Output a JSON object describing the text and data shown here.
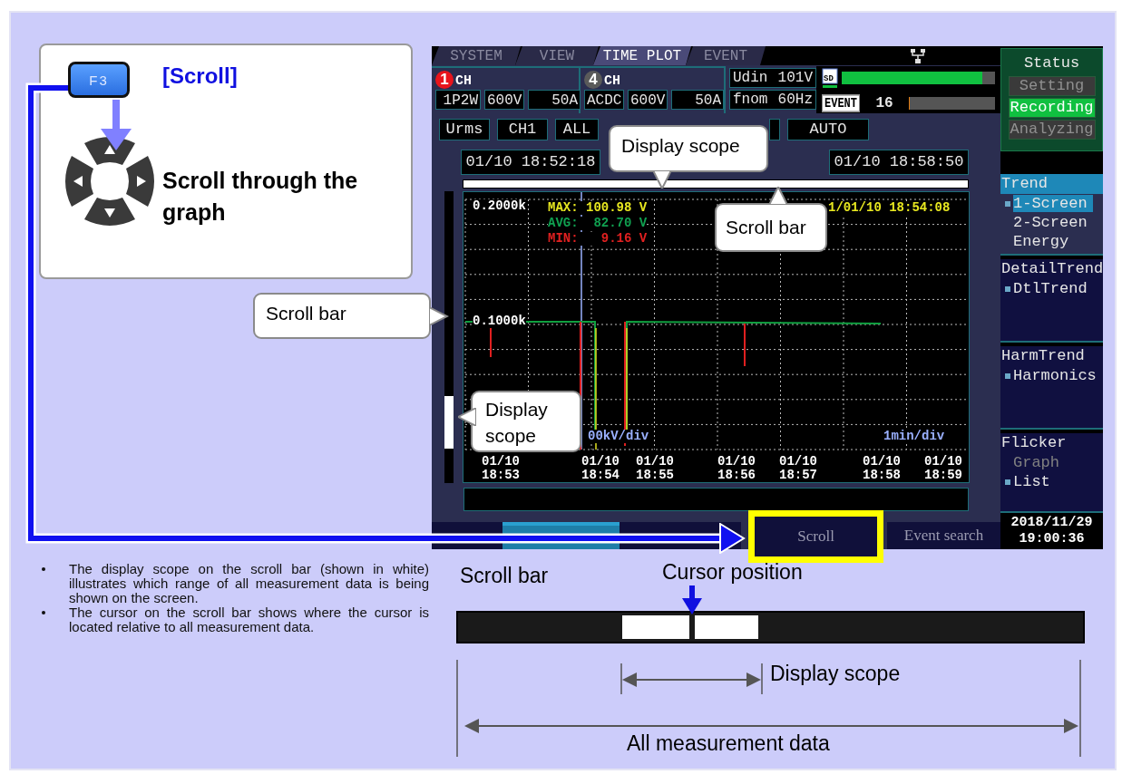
{
  "key_card": {
    "key_label": "F3",
    "title": "[Scroll]",
    "description": "Scroll through the graph"
  },
  "screen": {
    "tabs": [
      {
        "label": "SYSTEM",
        "selected": false
      },
      {
        "label": "VIEW",
        "selected": false
      },
      {
        "label": "TIME PLOT",
        "selected": true
      },
      {
        "label": "EVENT",
        "selected": false
      }
    ],
    "channels": [
      {
        "number": "1",
        "label": "CH",
        "color": "#e8141c",
        "fields": [
          "1P2W",
          "600V",
          "50A"
        ]
      },
      {
        "number": "4",
        "label": "CH",
        "color": "#5a5a5a",
        "fields": [
          "ACDC",
          "600V",
          "50A"
        ]
      }
    ],
    "nominal": [
      {
        "label": "Udin",
        "value": "101V"
      },
      {
        "label": "fnom",
        "value": "60Hz"
      }
    ],
    "sd": {
      "label": "SD",
      "level": 0.92
    },
    "event": {
      "badge": "EVENT",
      "count": "16",
      "level": 0.01
    },
    "status": {
      "title": "Status",
      "items": [
        {
          "label": "Setting",
          "selected": false
        },
        {
          "label": "Recording",
          "selected": true
        },
        {
          "label": "Analyzing",
          "selected": false
        }
      ]
    },
    "selectors": [
      {
        "kind": "text",
        "label": "Urms"
      },
      {
        "kind": "text",
        "label": "CH1"
      },
      {
        "kind": "text",
        "label": "ALL"
      },
      {
        "kind": "covered"
      },
      {
        "kind": "text",
        "label": "AUTO"
      }
    ],
    "start_time": "01/10 18:52:18",
    "end_time": "01/10 18:58:50",
    "graph": {
      "y_ticks": [
        "0.2000k",
        "0.1000k"
      ],
      "max": "MAX: 100.98 V",
      "avg": "AVG:  82.70 V",
      "min": "MIN:   9.16 V",
      "cursor_time": "1/01/10 18:54:08",
      "y_scale": "00kV/div",
      "x_scale": "1min/div",
      "x_labels": [
        {
          "date": "01/10",
          "time": "18:53"
        },
        {
          "date": "01/10",
          "time": "18:54"
        },
        {
          "date": "01/10",
          "time": "18:55"
        },
        {
          "date": "01/10",
          "time": "18:56"
        },
        {
          "date": "01/10",
          "time": "18:57"
        },
        {
          "date": "01/10",
          "time": "18:58"
        },
        {
          "date": "01/10",
          "time": "18:59"
        }
      ]
    },
    "sidebar": [
      {
        "title": "Trend",
        "selected": true,
        "items": [
          {
            "label": "1-Screen",
            "selected": true,
            "current": true,
            "disabled": false
          },
          {
            "label": "2-Screen",
            "selected": false,
            "current": false,
            "disabled": false
          },
          {
            "label": "Energy",
            "selected": false,
            "current": false,
            "disabled": false
          }
        ]
      },
      {
        "title": "DetailTrend",
        "selected": false,
        "items": [
          {
            "label": "DtlTrend",
            "selected": false,
            "current": true,
            "disabled": false
          }
        ]
      },
      {
        "title": "HarmTrend",
        "selected": false,
        "items": [
          {
            "label": "Harmonics",
            "selected": false,
            "current": true,
            "disabled": false
          }
        ]
      },
      {
        "title": "Flicker",
        "selected": false,
        "items": [
          {
            "label": "Graph",
            "selected": false,
            "current": false,
            "disabled": true
          },
          {
            "label": "List",
            "selected": false,
            "current": true,
            "disabled": false
          }
        ]
      }
    ],
    "date": "2018/11/29",
    "time": "19:00:36",
    "keys": [
      {
        "kind": "blank",
        "selected": false,
        "highlighted": false
      },
      {
        "kind": "blank",
        "selected": true,
        "highlighted": false
      },
      {
        "kind": "blank",
        "selected": false,
        "highlighted": false
      },
      {
        "kind": "label",
        "label": "Scroll",
        "selected": false,
        "highlighted": true
      },
      {
        "kind": "label",
        "label": "Event search",
        "selected": false,
        "highlighted": false
      }
    ]
  },
  "callouts": [
    {
      "text": "Display scope"
    },
    {
      "text": "Scroll bar"
    },
    {
      "text": "Scroll bar"
    },
    {
      "text": "Display scope"
    }
  ],
  "notes": [
    "The display scope on the scroll bar (shown in white) illustrates which range of all measurement data is being shown on the screen.",
    "The cursor on the scroll bar shows where the cursor is located relative to all measurement data."
  ],
  "diagram": {
    "scroll_bar_label": "Scroll bar",
    "cursor_label": "Cursor position",
    "scope_label": "Display scope",
    "all_label": "All measurement data"
  }
}
